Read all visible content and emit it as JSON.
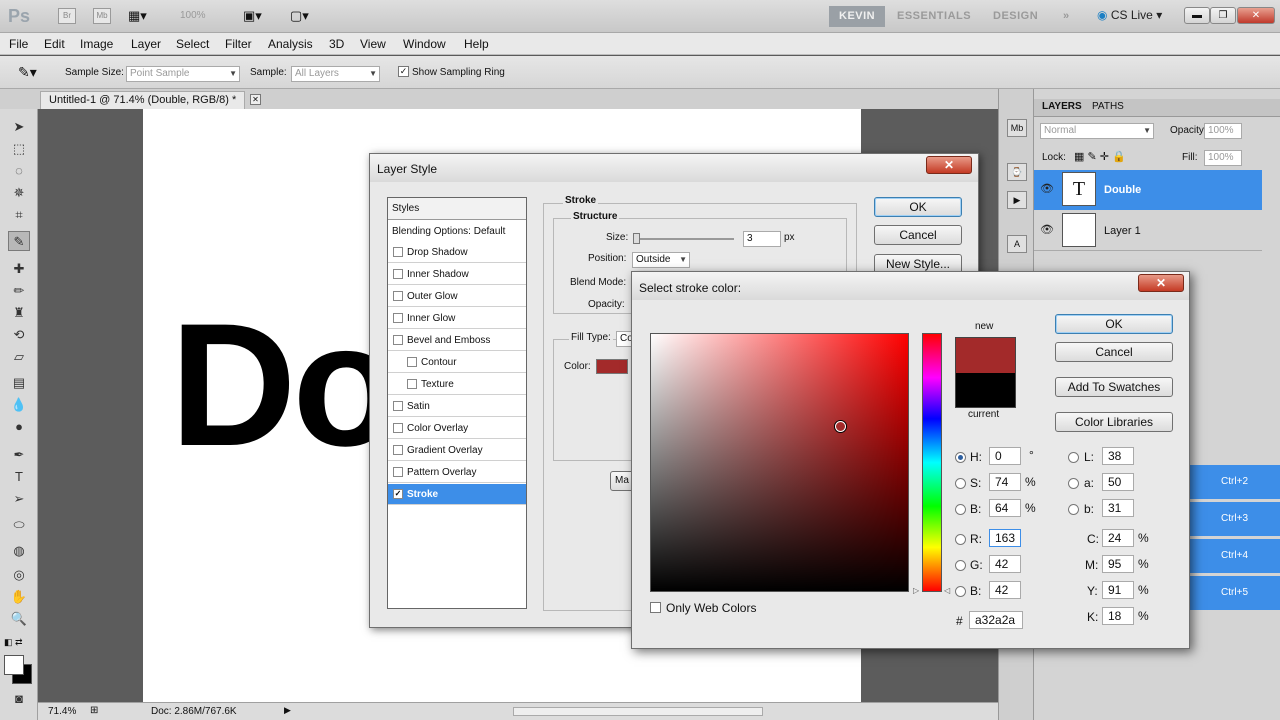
{
  "app": {
    "logo": "Ps",
    "bridge_icon": "Br",
    "minibridge_icon": "Mb",
    "zoom": "100%",
    "workspaces": {
      "active": "KEVIN",
      "essentials": "ESSENTIALS",
      "design": "DESIGN",
      "more": "»"
    },
    "cs_live": "CS Live"
  },
  "menu": [
    "File",
    "Edit",
    "Image",
    "Layer",
    "Select",
    "Filter",
    "Analysis",
    "3D",
    "View",
    "Window",
    "Help"
  ],
  "options": {
    "sample_size_label": "Sample Size:",
    "sample_size_value": "Point Sample",
    "sample_label": "Sample:",
    "sample_value": "All Layers",
    "show_ring_label": "Show Sampling Ring"
  },
  "document": {
    "tab_title": "Untitled-1 @ 71.4% (Double, RGB/8) *",
    "canvas_text": "Do",
    "zoom": "71.4%",
    "doc_info": "Doc: 2.86M/767.6K"
  },
  "layers_panel": {
    "tab_layers": "LAYERS",
    "tab_paths": "PATHS",
    "blend_mode": "Normal",
    "opacity_label": "Opacity:",
    "opacity_value": "100%",
    "lock_label": "Lock:",
    "fill_label": "Fill:",
    "fill_value": "100%",
    "layers": [
      {
        "name": "Double",
        "thumb": "T"
      },
      {
        "name": "Layer 1"
      }
    ],
    "shortcuts": [
      "Ctrl+2",
      "Ctrl+3",
      "Ctrl+4",
      "Ctrl+5"
    ]
  },
  "layer_style": {
    "title": "Layer Style",
    "styles_header": "Styles",
    "blending_options": "Blending Options: Default",
    "items": [
      {
        "label": "Drop Shadow",
        "checked": false,
        "sub": false
      },
      {
        "label": "Inner Shadow",
        "checked": false,
        "sub": false
      },
      {
        "label": "Outer Glow",
        "checked": false,
        "sub": false
      },
      {
        "label": "Inner Glow",
        "checked": false,
        "sub": false
      },
      {
        "label": "Bevel and Emboss",
        "checked": false,
        "sub": false
      },
      {
        "label": "Contour",
        "checked": false,
        "sub": true
      },
      {
        "label": "Texture",
        "checked": false,
        "sub": true
      },
      {
        "label": "Satin",
        "checked": false,
        "sub": false
      },
      {
        "label": "Color Overlay",
        "checked": false,
        "sub": false
      },
      {
        "label": "Gradient Overlay",
        "checked": false,
        "sub": false
      },
      {
        "label": "Pattern Overlay",
        "checked": false,
        "sub": false
      },
      {
        "label": "Stroke",
        "checked": true,
        "sub": false
      }
    ],
    "stroke_title": "Stroke",
    "structure_title": "Structure",
    "size_label": "Size:",
    "size_value": "3",
    "size_unit": "px",
    "position_label": "Position:",
    "position_value": "Outside",
    "blend_mode_label": "Blend Mode:",
    "opacity_label": "Opacity:",
    "fill_type_label": "Fill Type:",
    "fill_type_value": "Co",
    "color_label": "Color:",
    "stroke_color": "#a32a2a",
    "make_default_stub": "Ma",
    "ok": "OK",
    "cancel": "Cancel",
    "new_style": "New Style..."
  },
  "color_picker": {
    "title": "Select stroke color:",
    "new_label": "new",
    "current_label": "current",
    "new_color": "#a32a2a",
    "current_color": "#000000",
    "ok": "OK",
    "cancel": "Cancel",
    "add_swatches": "Add To Swatches",
    "color_libraries": "Color Libraries",
    "only_web_colors": "Only Web Colors",
    "hsb": {
      "H": "0",
      "S": "74",
      "B": "64"
    },
    "rgb": {
      "R": "163",
      "G": "42",
      "B": "42"
    },
    "lab": {
      "L": "38",
      "a": "50",
      "b": "31"
    },
    "cmyk": {
      "C": "24",
      "M": "95",
      "Y": "91",
      "K": "18"
    },
    "hex": "a32a2a",
    "units": {
      "degree": "°",
      "percent": "%",
      "hash": "#"
    }
  }
}
